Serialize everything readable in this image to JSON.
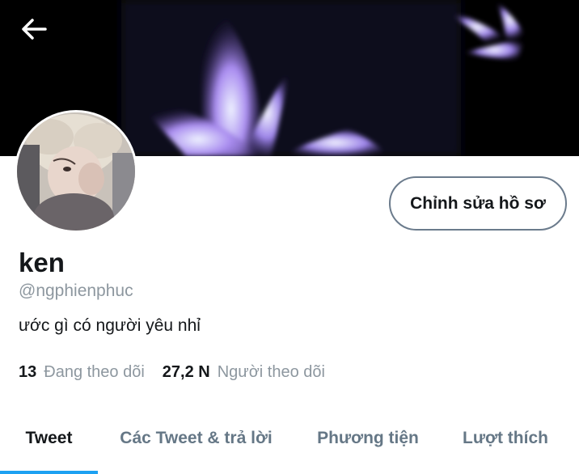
{
  "profile": {
    "display_name": "ken",
    "handle": "@ngphienphuc",
    "bio": "ước gì có người yêu nhỉ"
  },
  "actions": {
    "edit_profile_label": "Chỉnh sửa hồ sơ",
    "back_icon": "arrow-left-icon"
  },
  "stats": {
    "following_count": "13",
    "following_label": "Đang theo dõi",
    "followers_count": "27,2 N",
    "followers_label": "Người theo dõi"
  },
  "tabs": [
    {
      "label": "Tweet",
      "active": true
    },
    {
      "label": "Các Tweet & trả lời",
      "active": false
    },
    {
      "label": "Phương tiện",
      "active": false
    },
    {
      "label": "Lượt thích",
      "active": false
    }
  ],
  "colors": {
    "accent": "#1da1f2",
    "text_primary": "#14171a",
    "text_secondary": "#8d979f",
    "banner_bg": "#000000"
  }
}
